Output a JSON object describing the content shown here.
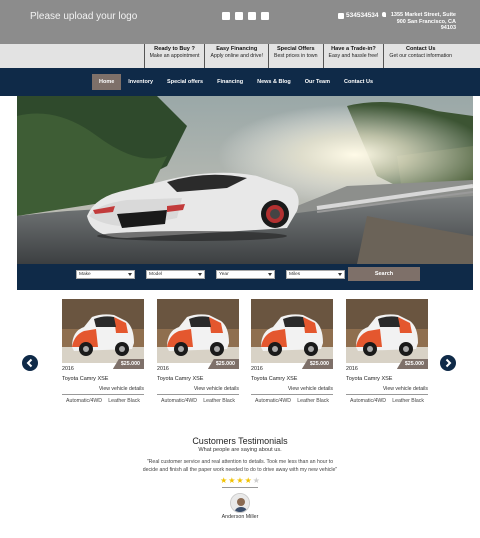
{
  "header": {
    "logo_text": "Please upload your logo",
    "social_icons": [
      "facebook-icon",
      "twitter-icon",
      "instagram-icon",
      "youtube-icon"
    ],
    "phone": "534534534",
    "address": "1355 Market Street, Suite 900 San Francisco, CA 94103"
  },
  "subnav": [
    {
      "title": "Ready to Buy ?",
      "subtitle": "Make an appointment"
    },
    {
      "title": "Easy Financing",
      "subtitle": "Apply online and drive!"
    },
    {
      "title": "Special Offers",
      "subtitle": "Best prices in town"
    },
    {
      "title": "Have a Trade-in?",
      "subtitle": "Easy and hassle free!"
    },
    {
      "title": "Contact Us",
      "subtitle": "Get our contact information"
    }
  ],
  "mainnav": {
    "active_index": 0,
    "items": [
      "Home",
      "Inventory",
      "Special offers",
      "Financing",
      "News & Blog",
      "Our Team",
      "Contact Us"
    ]
  },
  "search": {
    "make": "Make",
    "model": "Model",
    "year": "Year",
    "miles": "Miles",
    "button": "Search"
  },
  "cars": [
    {
      "year": "2016",
      "price": "$25.000",
      "name": "Toyota Camry XSE",
      "view": "View vehicle details",
      "transmission": "Automatic/4WD",
      "interior": "Leather Black"
    },
    {
      "year": "2016",
      "price": "$25.000",
      "name": "Toyota Camry XSE",
      "view": "View vehicle details",
      "transmission": "Automatic/4WD",
      "interior": "Leather Black"
    },
    {
      "year": "2016",
      "price": "$25.000",
      "name": "Toyota Camry XSE",
      "view": "View vehicle details",
      "transmission": "Automatic/4WD",
      "interior": "Leather Black"
    },
    {
      "year": "2016",
      "price": "$25.000",
      "name": "Toyota Camry XSE",
      "view": "View vehicle details",
      "transmission": "Automatic/4WD",
      "interior": "Leather Black"
    }
  ],
  "testimonials": {
    "title": "Customers Testimonials",
    "subtitle": "What people are saying about us.",
    "quote": "\"Real customer service and real attention to details. Took me less than an hour to decide and finish all the paper work needed to do to drive away with my new vehicle\"",
    "rating": 4,
    "rating_max": 5,
    "author": "Anderson Miller"
  },
  "colors": {
    "navy": "#0f2a48",
    "accent": "#7e7069",
    "topbar": "#8c8c8c",
    "star": "#f2c200"
  }
}
